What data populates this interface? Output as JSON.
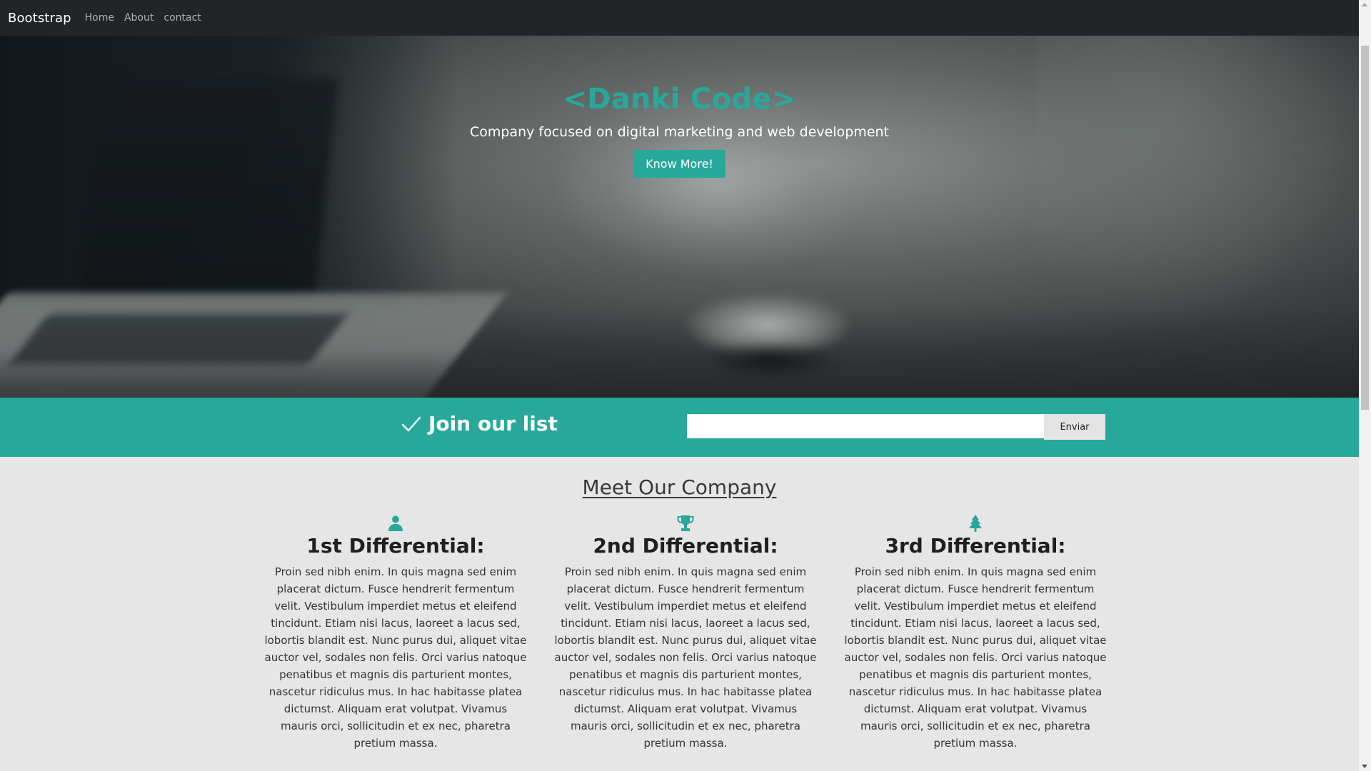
{
  "navbar": {
    "brand": "Bootstrap",
    "links": [
      "Home",
      "About",
      "contact"
    ]
  },
  "hero": {
    "title": "<Danki Code>",
    "subtitle": "Company focused on digital marketing and web development",
    "button_label": "Know More!"
  },
  "join": {
    "title": "Join our list",
    "icon": "check-icon",
    "input_value": "",
    "button_label": "Enviar"
  },
  "company": {
    "title": "Meet Our Company",
    "columns": [
      {
        "icon": "user-icon",
        "title": "1st Differential:",
        "text": "Proin sed nibh enim. In quis magna sed enim placerat dictum. Fusce hendrerit fermentum velit. Vestibulum imperdiet metus et eleifend tincidunt. Etiam nisi lacus, laoreet a lacus sed, lobortis blandit est. Nunc purus dui, aliquet vitae auctor vel, sodales non felis. Orci varius natoque penatibus et magnis dis parturient montes, nascetur ridiculus mus. In hac habitasse platea dictumst. Aliquam erat volutpat. Vivamus mauris orci, sollicitudin et ex nec, pharetra pretium massa."
      },
      {
        "icon": "trophy-icon",
        "title": "2nd Differential:",
        "text": "Proin sed nibh enim. In quis magna sed enim placerat dictum. Fusce hendrerit fermentum velit. Vestibulum imperdiet metus et eleifend tincidunt. Etiam nisi lacus, laoreet a lacus sed, lobortis blandit est. Nunc purus dui, aliquet vitae auctor vel, sodales non felis. Orci varius natoque penatibus et magnis dis parturient montes, nascetur ridiculus mus. In hac habitasse platea dictumst. Aliquam erat volutpat. Vivamus mauris orci, sollicitudin et ex nec, pharetra pretium massa."
      },
      {
        "icon": "tree-icon",
        "title": "3rd Differential:",
        "text": "Proin sed nibh enim. In quis magna sed enim placerat dictum. Fusce hendrerit fermentum velit. Vestibulum imperdiet metus et eleifend tincidunt. Etiam nisi lacus, laoreet a lacus sed, lobortis blandit est. Nunc purus dui, aliquet vitae auctor vel, sodales non felis. Orci varius natoque penatibus et magnis dis parturient montes, nascetur ridiculus mus. In hac habitasse platea dictumst. Aliquam erat volutpat. Vivamus mauris orci, sollicitudin et ex nec, pharetra pretium massa."
      }
    ]
  },
  "colors": {
    "accent": "#27a89b",
    "navbar_bg": "#222528",
    "page_bg": "#e6e6e6"
  }
}
